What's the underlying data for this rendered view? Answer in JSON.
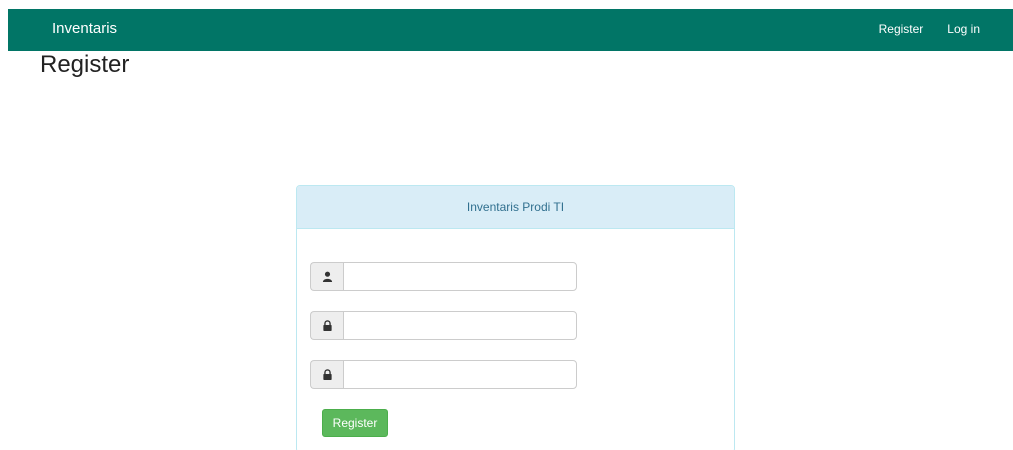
{
  "navbar": {
    "brand": "Inventaris",
    "links": [
      {
        "label": "Register"
      },
      {
        "label": "Log in"
      }
    ],
    "background": "#017566"
  },
  "page": {
    "title": "Register"
  },
  "panel": {
    "heading": "Inventaris Prodi TI",
    "fields": [
      {
        "icon": "user-icon",
        "value": "",
        "placeholder": ""
      },
      {
        "icon": "lock-icon",
        "value": "",
        "placeholder": ""
      },
      {
        "icon": "lock-icon",
        "value": "",
        "placeholder": ""
      }
    ],
    "submit_label": "Register",
    "submit_color": "#5cb85c"
  }
}
